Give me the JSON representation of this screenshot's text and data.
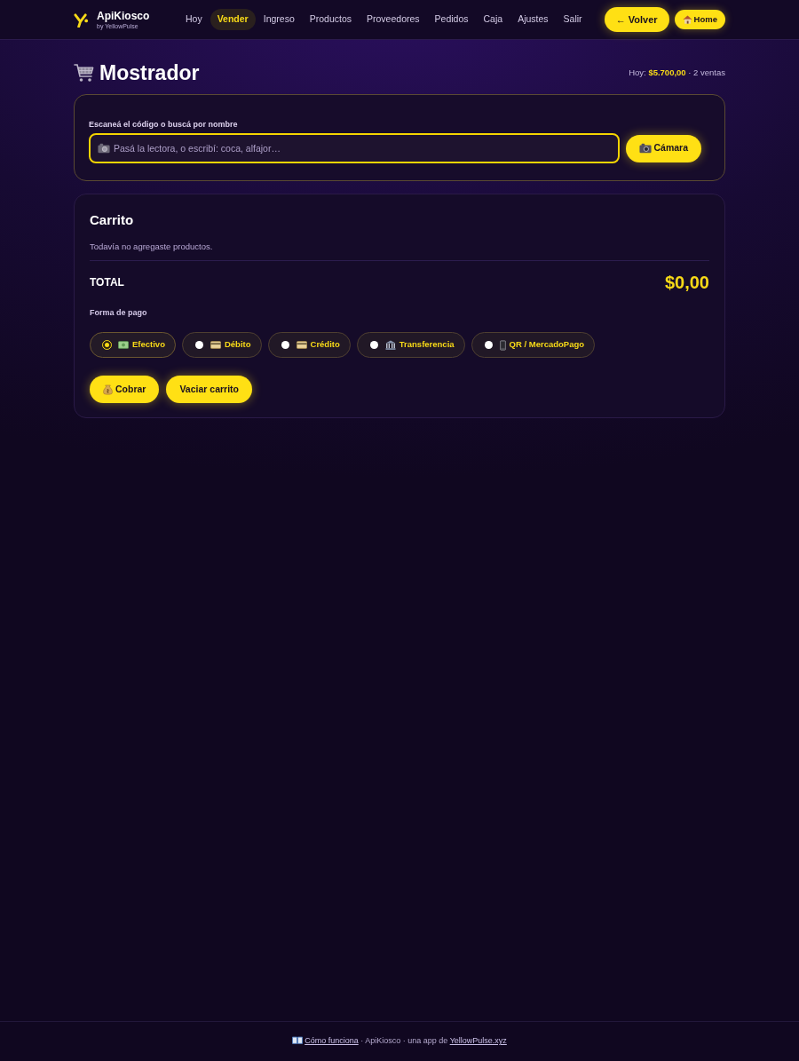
{
  "header": {
    "brand": {
      "name": "ApiKiosco",
      "tagline": "by YellowPulse"
    },
    "nav": [
      {
        "label": "Hoy",
        "selected": false
      },
      {
        "label": "Vender",
        "selected": true
      },
      {
        "label": "Ingreso",
        "selected": false
      },
      {
        "label": "Productos",
        "selected": false
      },
      {
        "label": "Proveedores",
        "selected": false
      },
      {
        "label": "Pedidos",
        "selected": false
      },
      {
        "label": "Caja",
        "selected": false
      },
      {
        "label": "Ajustes",
        "selected": false
      },
      {
        "label": "Salir",
        "selected": false
      }
    ],
    "actions": [
      {
        "kind": "back",
        "label": "← Volver"
      },
      {
        "kind": "home",
        "label": "Home"
      }
    ]
  },
  "page": {
    "title": "Mostrador",
    "summary": "Hoy: **$5.700,00** · 2 ventas"
  },
  "scan": {
    "label": "Escaneá el código o buscá por nombre",
    "placeholder": "Pasá la lectora, o escribí: coca, alfajor…",
    "camera_button": "Cámara"
  },
  "cart": {
    "title": "Carrito",
    "empty_message": "Todavía no agregaste productos.",
    "total_label": "TOTAL",
    "total": "$0,00",
    "payment_label": "Forma de pago",
    "payment_methods": [
      {
        "kind": "cash",
        "label": "Efectivo",
        "selected": true
      },
      {
        "kind": "debit",
        "label": "Débito",
        "selected": false
      },
      {
        "kind": "credit",
        "label": "Crédito",
        "selected": false
      },
      {
        "kind": "transfer",
        "label": "Transferencia",
        "selected": false
      },
      {
        "kind": "qr",
        "label": "QR / MercadoPago",
        "selected": false
      }
    ],
    "buttons": [
      {
        "kind": "charge",
        "label": "Cobrar"
      },
      {
        "kind": "clear",
        "label": "Vaciar carrito"
      }
    ]
  },
  "footer": {
    "help_link": "Cómo funciona",
    "text": " · ApiKiosco · una app de ",
    "site_link": "YellowPulse.xyz"
  }
}
